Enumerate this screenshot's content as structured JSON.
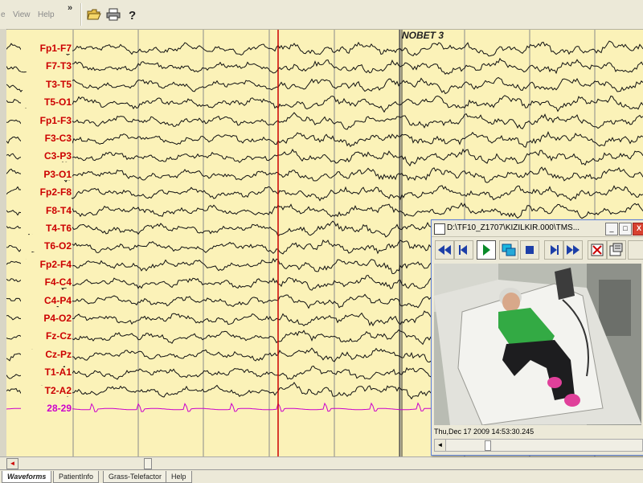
{
  "menu": {
    "items": [
      "e",
      "View",
      "Help"
    ],
    "chevron": "»"
  },
  "toolbar": {
    "icons": [
      "open-folder-icon",
      "print-icon",
      "help-icon"
    ]
  },
  "eeg": {
    "event_marker": "NOBET 3",
    "channels": [
      {
        "label": "Fp1-F7",
        "color": "#cc0000"
      },
      {
        "label": "F7-T3",
        "color": "#cc0000"
      },
      {
        "label": "T3-T5",
        "color": "#cc0000"
      },
      {
        "label": "T5-O1",
        "color": "#cc0000"
      },
      {
        "label": "Fp1-F3",
        "color": "#cc0000"
      },
      {
        "label": "F3-C3",
        "color": "#cc0000"
      },
      {
        "label": "C3-P3",
        "color": "#cc0000"
      },
      {
        "label": "P3-O1",
        "color": "#cc0000"
      },
      {
        "label": "Fp2-F8",
        "color": "#cc0000"
      },
      {
        "label": "F8-T4",
        "color": "#cc0000"
      },
      {
        "label": "T4-T6",
        "color": "#cc0000"
      },
      {
        "label": "T6-O2",
        "color": "#cc0000"
      },
      {
        "label": "Fp2-F4",
        "color": "#cc0000"
      },
      {
        "label": "F4-C4",
        "color": "#cc0000"
      },
      {
        "label": "C4-P4",
        "color": "#cc0000"
      },
      {
        "label": "P4-O2",
        "color": "#cc0000"
      },
      {
        "label": "Fz-Cz",
        "color": "#cc0000"
      },
      {
        "label": "Cz-Pz",
        "color": "#cc0000"
      },
      {
        "label": "T1-A1",
        "color": "#cc0000"
      },
      {
        "label": "T2-A2",
        "color": "#cc0000"
      },
      {
        "label": "28-29",
        "color": "#cc00cc"
      }
    ],
    "background": "#fbf2b8",
    "trace_color": "#111111",
    "ecg_trace_color": "#cc00cc",
    "cursor_color": "#cc0000"
  },
  "video": {
    "title": "D:\\TF10_Z1707\\KIZILKIR.000\\TMS...",
    "minimize_label": "_",
    "maximize_label": "□",
    "close_label": "X",
    "timestamp": "Thu,Dec 17 2009  14:53:30.245",
    "controls": [
      "rewind-icon",
      "step-back-icon",
      "play-icon",
      "loop-icon",
      "stop-icon",
      "step-forward-icon",
      "fast-forward-icon",
      "fullscreen-icon",
      "snapshot-icon"
    ]
  },
  "tabs": [
    {
      "label": "Waveforms",
      "active": true
    },
    {
      "label": "PatientInfo",
      "active": false
    },
    {
      "label": "Grass-Telefactor",
      "active": false
    },
    {
      "label": "Help",
      "active": false
    }
  ],
  "scroll": {
    "left_arrow": "◄"
  }
}
